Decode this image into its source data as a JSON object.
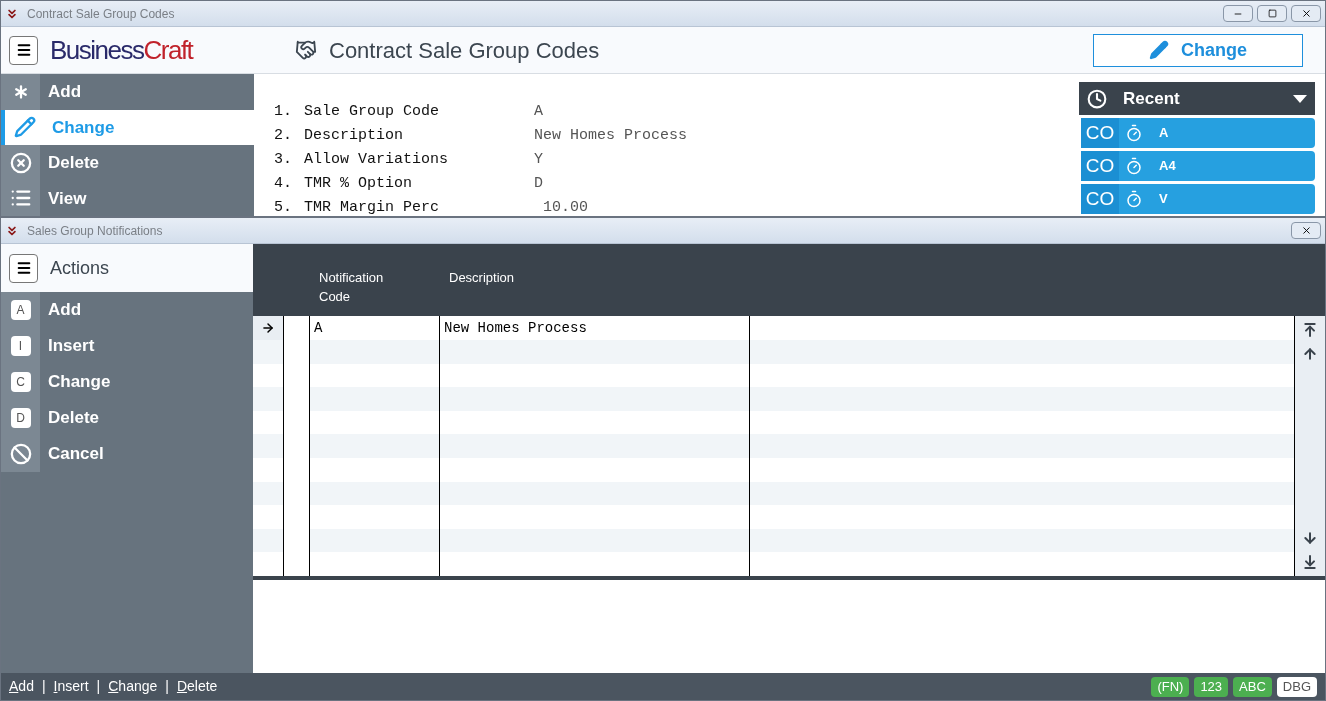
{
  "main_window": {
    "title": "Contract Sale Group Codes",
    "logo": {
      "part_1": "Business",
      "part_2": "Craft"
    },
    "page_title": "Contract Sale Group Codes",
    "mode_button": "Change",
    "sidebar": [
      {
        "label": "Add",
        "kind": "asterisk",
        "selected": false
      },
      {
        "label": "Change",
        "kind": "pencil",
        "selected": true
      },
      {
        "label": "Delete",
        "kind": "cross",
        "selected": false
      },
      {
        "label": "View",
        "kind": "list",
        "selected": false
      }
    ],
    "fields": [
      {
        "number": "1.",
        "label": "Sale Group Code",
        "value": "A"
      },
      {
        "number": "2.",
        "label": "Description",
        "value": "New Homes Process"
      },
      {
        "number": "3.",
        "label": "Allow Variations",
        "value": "Y"
      },
      {
        "number": "4.",
        "label": "TMR % Option",
        "value": "D"
      },
      {
        "number": "5.",
        "label": "TMR Margin Perc",
        "value": " 10.00"
      }
    ],
    "recent": {
      "title": "Recent",
      "items": [
        {
          "prefix": "CO",
          "label": "A"
        },
        {
          "prefix": "CO",
          "label": "A4"
        },
        {
          "prefix": "CO",
          "label": "V"
        }
      ]
    }
  },
  "sub_window": {
    "title": "Sales Group Notifications",
    "actions_title": "Actions",
    "actions": [
      {
        "key": "A",
        "label": "Add",
        "kind": "letter"
      },
      {
        "key": "I",
        "label": "Insert",
        "kind": "letter"
      },
      {
        "key": "C",
        "label": "Change",
        "kind": "letter"
      },
      {
        "key": "D",
        "label": "Delete",
        "kind": "letter"
      },
      {
        "label": "Cancel",
        "kind": "cancel"
      }
    ],
    "table": {
      "columns": [
        "Notification Code",
        "Description"
      ],
      "rows": [
        {
          "selected": true,
          "cells": [
            "A",
            "New Homes Process"
          ]
        }
      ]
    },
    "status_bar": {
      "links": [
        "Add",
        "Insert",
        "Change",
        "Delete"
      ],
      "separator": "|",
      "badges": [
        {
          "label": "(FN)",
          "on": true
        },
        {
          "label": "123",
          "on": true
        },
        {
          "label": "ABC",
          "on": true
        },
        {
          "label": "DBG",
          "on": false
        }
      ]
    }
  }
}
